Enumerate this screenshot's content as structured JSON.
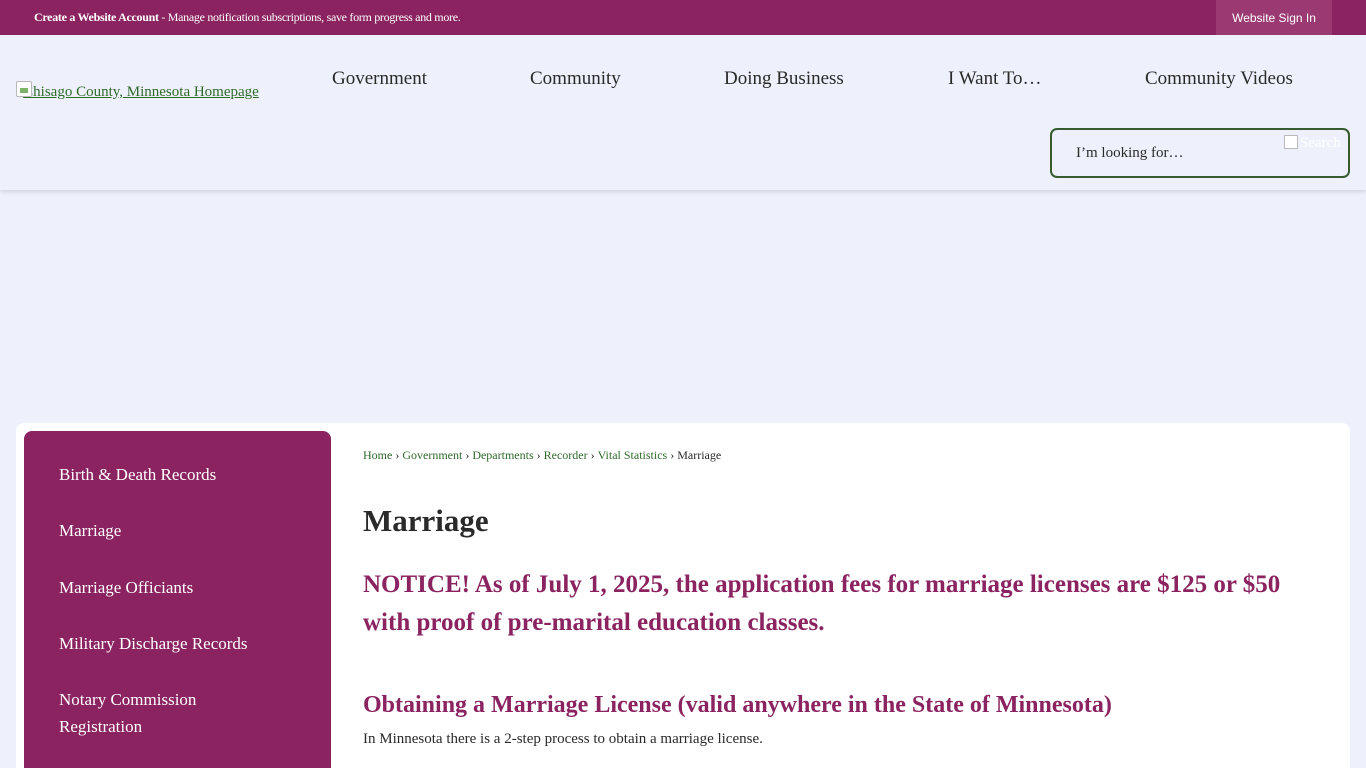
{
  "topbar": {
    "create_account": "Create a Website Account",
    "tagline": " - Manage notification subscriptions, save form progress and more.",
    "signin_label": "Website Sign In"
  },
  "header": {
    "logo_alt": "Chisago County, Minnesota Homepage",
    "nav": [
      "Government",
      "Community",
      "Doing Business",
      "I Want To…",
      "Community Videos"
    ],
    "search": {
      "placeholder": "I’m looking for…",
      "button_alt": "Search"
    }
  },
  "sidebar": {
    "items": [
      "Birth & Death Records",
      "Marriage",
      "Marriage Officiants",
      "Military Discharge Records",
      "Notary Commission Registration"
    ]
  },
  "breadcrumb": {
    "links": [
      "Home",
      "Government",
      "Departments",
      "Recorder",
      "Vital Statistics"
    ],
    "current": "Marriage"
  },
  "content": {
    "title": "Marriage",
    "notice": "NOTICE!  As of July 1, 2025, the application fees for marriage licenses are $125 or $50 with proof of pre-marital education classes.",
    "subheading": "Obtaining a Marriage License (valid anywhere in the State of Minnesota)",
    "paragraph": "In Minnesota there is a 2-step process to obtain a marriage license."
  },
  "colors": {
    "brand": "#8a2360",
    "link": "#2f6a2b",
    "page_bg": "#eef1fb"
  }
}
